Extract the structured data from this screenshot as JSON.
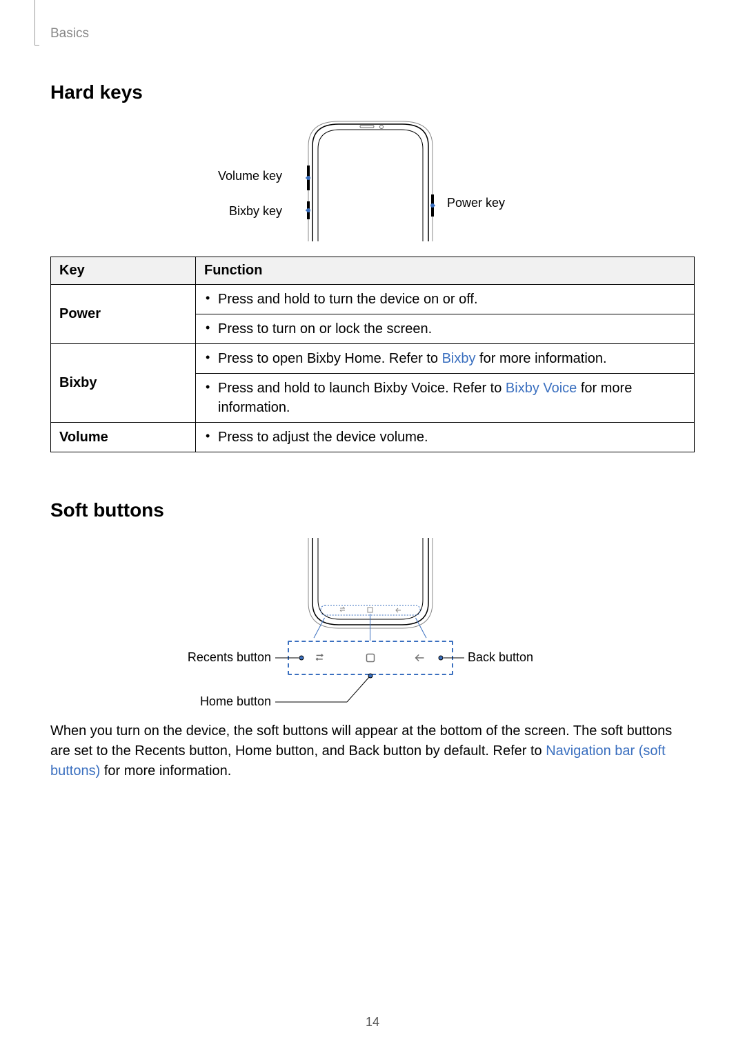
{
  "breadcrumb": "Basics",
  "section1_title": "Hard keys",
  "section2_title": "Soft buttons",
  "hardkeys_labels": {
    "volume": "Volume key",
    "bixby": "Bixby key",
    "power": "Power key"
  },
  "table": {
    "header_key": "Key",
    "header_fn": "Function",
    "rows": [
      {
        "key": "Power",
        "items": [
          {
            "text": "Press and hold to turn the device on or off."
          },
          {
            "text": "Press to turn on or lock the screen."
          }
        ]
      },
      {
        "key": "Bixby",
        "items": [
          {
            "pre": "Press to open Bixby Home. Refer to ",
            "link": "Bixby",
            "post": " for more information."
          },
          {
            "pre": "Press and hold to launch Bixby Voice. Refer to ",
            "link": "Bixby Voice",
            "post": " for more information."
          }
        ]
      },
      {
        "key": "Volume",
        "items": [
          {
            "text": "Press to adjust the device volume."
          }
        ]
      }
    ]
  },
  "softbtn_labels": {
    "recents": "Recents button",
    "home": "Home button",
    "back": "Back button"
  },
  "paragraph": {
    "pre": "When you turn on the device, the soft buttons will appear at the bottom of the screen. The soft buttons are set to the Recents button, Home button, and Back button by default. Refer to ",
    "link": "Navigation bar (soft buttons)",
    "post": " for more information."
  },
  "page_number": "14"
}
